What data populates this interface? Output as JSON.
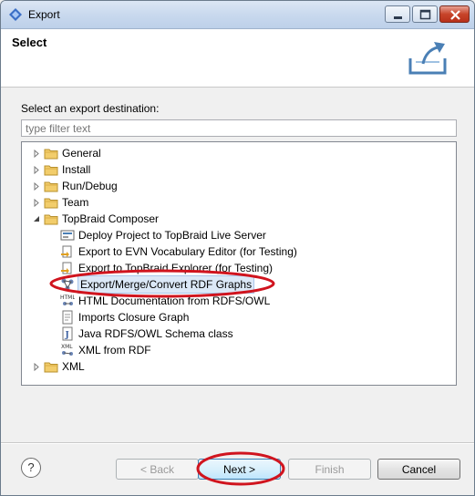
{
  "window": {
    "title": "Export",
    "controls": [
      "minimize",
      "maximize",
      "close"
    ]
  },
  "header": {
    "title": "Select",
    "icon": "export-icon"
  },
  "destination_label": "Select an export destination:",
  "filter": {
    "value": "",
    "placeholder": "type filter text"
  },
  "tree": {
    "categories": [
      {
        "label": "General",
        "expanded": false
      },
      {
        "label": "Install",
        "expanded": false
      },
      {
        "label": "Run/Debug",
        "expanded": false
      },
      {
        "label": "Team",
        "expanded": false
      },
      {
        "label": "TopBraid Composer",
        "expanded": true
      },
      {
        "label": "XML",
        "expanded": false
      }
    ],
    "children": [
      {
        "label": "Deploy Project to TopBraid Live Server",
        "icon": "deploy-icon"
      },
      {
        "label": "Export to EVN Vocabulary Editor (for Testing)",
        "icon": "export-evn-icon"
      },
      {
        "label": "Export to TopBraid Explorer (for Testing)",
        "icon": "export-explorer-icon"
      },
      {
        "label": "Export/Merge/Convert RDF Graphs",
        "icon": "rdf-graph-icon",
        "selected": true
      },
      {
        "label": "HTML Documentation from RDFS/OWL",
        "icon": "html-icon"
      },
      {
        "label": "Imports Closure Graph",
        "icon": "document-icon"
      },
      {
        "label": "Java RDFS/OWL Schema class",
        "icon": "java-icon"
      },
      {
        "label": "XML from RDF",
        "icon": "xml-icon"
      }
    ]
  },
  "buttons": {
    "help": "?",
    "back": "< Back",
    "next": "Next >",
    "finish": "Finish",
    "cancel": "Cancel"
  },
  "colors": {
    "annotation": "#d0141e",
    "selection": "#dbe8f7",
    "folder": "#e8b84a"
  }
}
